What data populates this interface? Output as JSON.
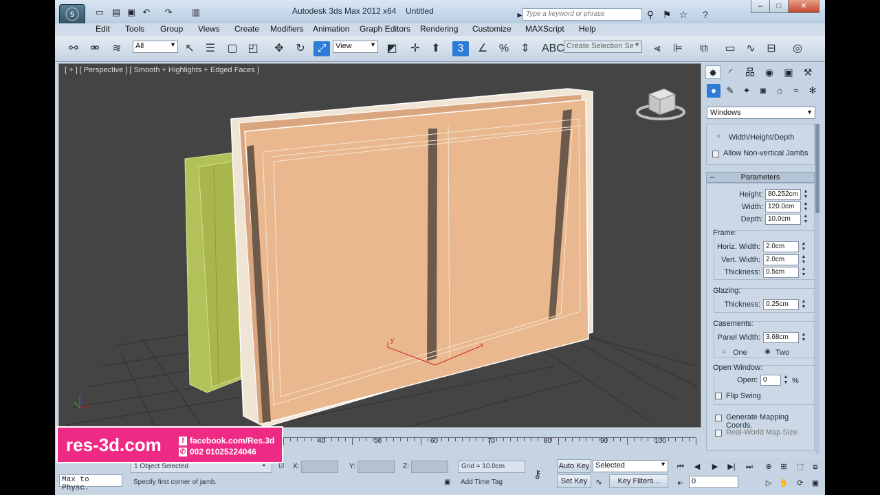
{
  "titlebar": {
    "app_title": "Autodesk 3ds Max  2012 x64",
    "doc_title": "Untitled",
    "search_placeholder": "Type a keyword or phrase",
    "logo_icon": "max-logo-icon"
  },
  "menu": [
    "Edit",
    "Tools",
    "Group",
    "Views",
    "Create",
    "Modifiers",
    "Animation",
    "Graph Editors",
    "Rendering",
    "Customize",
    "MAXScript",
    "Help"
  ],
  "toolbar": {
    "selection_filter": "All",
    "ref_coord": "View",
    "named_selection": "Create Selection Se"
  },
  "viewport": {
    "label": "[ + ] [ Perspective ] [ Smooth + Highlights + Edged Faces ]",
    "gizmo_x": "x",
    "gizmo_y": "y"
  },
  "command_panel": {
    "category": "Windows",
    "creation_method": {
      "width_height_depth": "Width/Height/Depth",
      "allow_nonvertical": "Allow Non-vertical Jambs"
    },
    "parameters_title": "Parameters",
    "collapse_symbol": "–",
    "height_label": "Height:",
    "height": "80.252cm",
    "width_label": "Width:",
    "width": "120.0cm",
    "depth_label": "Depth:",
    "depth": "10.0cm",
    "frame_label": "Frame:",
    "horiz_width_label": "Horiz. Width:",
    "horiz_width": "2.0cm",
    "vert_width_label": "Vert. Width:",
    "vert_width": "2.0cm",
    "frame_thickness_label": "Thickness:",
    "frame_thickness": "0.5cm",
    "glazing_label": "Glazing:",
    "glazing_thickness_label": "Thickness:",
    "glazing_thickness": "0.25cm",
    "casements_label": "Casements:",
    "panel_width_label": "Panel Width:",
    "panel_width": "3.68cm",
    "one_label": "One",
    "two_label": "Two",
    "open_window_label": "Open Window:",
    "open_label": "Open:",
    "open_value": "0",
    "open_unit": "%",
    "flip_swing": "Flip Swing",
    "gen_mapping": "Generate Mapping Coords.",
    "real_world": "Real-World Map Size"
  },
  "timeline": {
    "numbers": [
      "40",
      "50",
      "60",
      "70",
      "80",
      "90",
      "100"
    ]
  },
  "status": {
    "selected_text": "1 Object Selected",
    "prompt": "Specify first corner of jamb.",
    "x_label": "X:",
    "y_label": "Y:",
    "z_label": "Z:",
    "grid": "Grid = 10.0cm",
    "add_time_tag": "Add Time Tag",
    "auto_key": "Auto Key",
    "set_key": "Set Key",
    "key_mode": "Selected",
    "key_filters": "Key Filters...",
    "frame": "0",
    "maxscript": "Max to Physc."
  },
  "promo": {
    "site": "res-3d.com",
    "facebook": "facebook.com/Res.3d",
    "phone": "002 01025224046"
  }
}
